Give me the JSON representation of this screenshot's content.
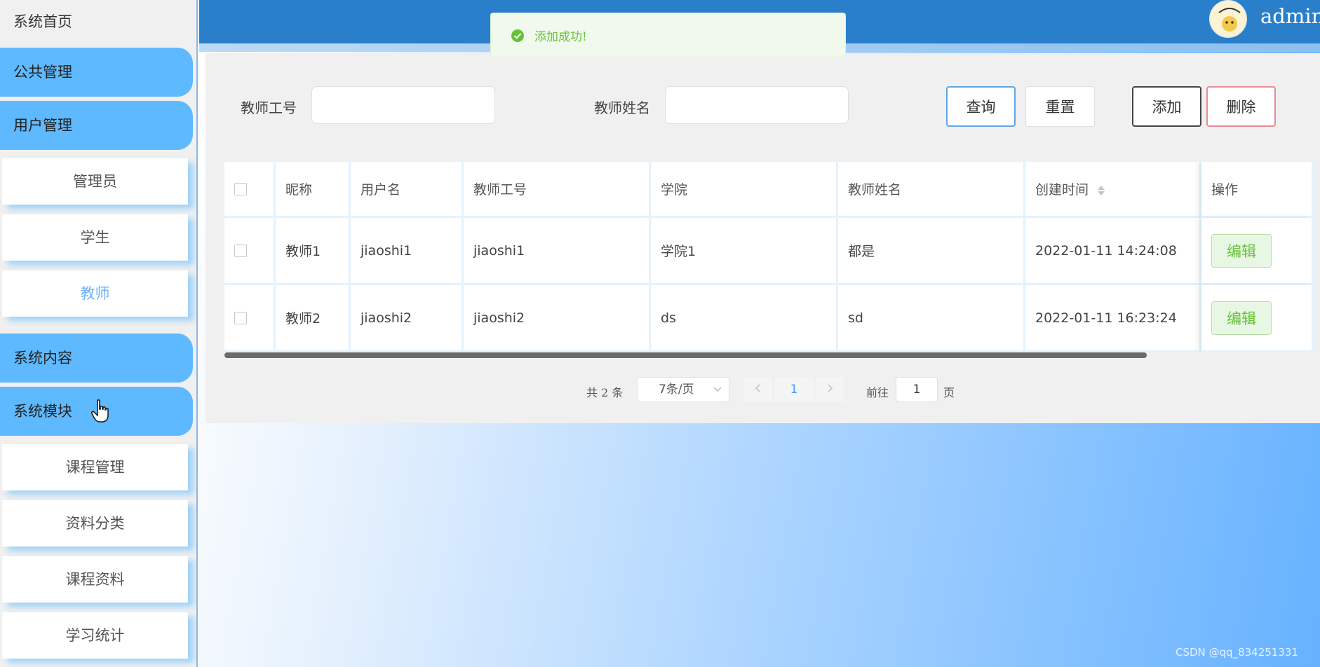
{
  "sidebar": {
    "home": "系统首页",
    "groups": [
      {
        "label": "公共管理"
      },
      {
        "label": "用户管理",
        "items": [
          "管理员",
          "学生",
          "教师"
        ],
        "active": "教师"
      },
      {
        "label": "系统内容"
      },
      {
        "label": "系统模块",
        "items": [
          "课程管理",
          "资料分类",
          "课程资料",
          "学习统计"
        ]
      }
    ]
  },
  "header": {
    "user": "admin"
  },
  "toast": {
    "message": "添加成功!",
    "type": "success"
  },
  "search": {
    "teacher_id_label": "教师工号",
    "teacher_id_value": "",
    "teacher_name_label": "教师姓名",
    "teacher_name_value": "",
    "query_label": "查询",
    "reset_label": "重置",
    "add_label": "添加",
    "delete_label": "删除"
  },
  "table": {
    "columns": [
      "昵称",
      "用户名",
      "教师工号",
      "学院",
      "教师姓名",
      "创建时间",
      "操作"
    ],
    "rows": [
      {
        "nickname": "教师1",
        "username": "jiaoshi1",
        "teacher_id": "jiaoshi1",
        "college": "学院1",
        "name": "都是",
        "created": "2022-01-11 14:24:08",
        "action": "编辑"
      },
      {
        "nickname": "教师2",
        "username": "jiaoshi2",
        "teacher_id": "jiaoshi2",
        "college": "ds",
        "name": "sd",
        "created": "2022-01-11 16:23:24",
        "action": "编辑"
      }
    ]
  },
  "pagination": {
    "total_text": "共 2 条",
    "page_size": "7条/页",
    "current_page": "1",
    "goto_prefix": "前往",
    "goto_value": "1",
    "goto_suffix": "页"
  },
  "watermark": "CSDN @qq_834251331",
  "colors": {
    "header": "#2a7fcb",
    "nav_group": "#5fb9ff",
    "active_item": "#6fb3ff",
    "success": "#67c23a"
  }
}
